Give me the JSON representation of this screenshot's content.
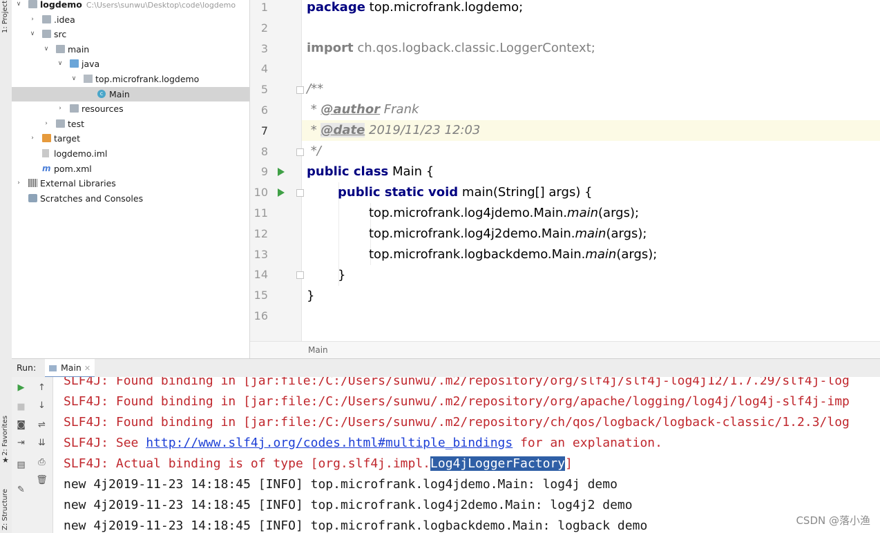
{
  "side_tabs": {
    "project": "1: Project",
    "favorites": "2: Favorites",
    "structure": "Z: Structure"
  },
  "project_tree": [
    {
      "label": "logdemo",
      "path": "C:\\Users\\sunwu\\Desktop\\code\\logdemo",
      "depth": 0,
      "expanded": true,
      "icon": "module-icon"
    },
    {
      "label": ".idea",
      "depth": 1,
      "expanded": false,
      "icon": "folder-icon"
    },
    {
      "label": "src",
      "depth": 1,
      "expanded": true,
      "icon": "folder-icon"
    },
    {
      "label": "main",
      "depth": 2,
      "expanded": true,
      "icon": "folder-icon"
    },
    {
      "label": "java",
      "depth": 3,
      "expanded": true,
      "icon": "source-folder-icon"
    },
    {
      "label": "top.microfrank.logdemo",
      "depth": 4,
      "expanded": true,
      "icon": "package-icon"
    },
    {
      "label": "Main",
      "depth": 5,
      "selected": true,
      "icon": "class-icon"
    },
    {
      "label": "resources",
      "depth": 3,
      "expanded": false,
      "icon": "resources-folder-icon"
    },
    {
      "label": "test",
      "depth": 2,
      "expanded": false,
      "icon": "folder-icon"
    },
    {
      "label": "target",
      "depth": 1,
      "expanded": false,
      "icon": "excluded-folder-icon"
    },
    {
      "label": "logdemo.iml",
      "depth": 1,
      "icon": "iml-file-icon"
    },
    {
      "label": "pom.xml",
      "depth": 1,
      "icon": "maven-icon"
    },
    {
      "label": "External Libraries",
      "depth": 0,
      "expanded": false,
      "icon": "libraries-icon"
    },
    {
      "label": "Scratches and Consoles",
      "depth": 0,
      "icon": "scratches-icon"
    }
  ],
  "editor": {
    "line_numbers": [
      "1",
      "2",
      "3",
      "4",
      "5",
      "6",
      "7",
      "8",
      "9",
      "10",
      "11",
      "12",
      "13",
      "14",
      "15",
      "16"
    ],
    "lines": {
      "l1_kw": "package",
      "l1_rest": " top.microfrank.logdemo;",
      "l3_kw": "import",
      "l3_rest": " ch.qos.logback.classic.LoggerContext;",
      "l5": "/**",
      "l6_pre": " * ",
      "l6_tag": "@author",
      "l6_val": " Frank",
      "l7_pre": " * ",
      "l7_tag": "@date",
      "l7_val": " 2019/11/23 12:03",
      "l8": " */",
      "l9_kw": "public class",
      "l9_rest": " Main {",
      "l10_kw": "public static void",
      "l10_rest": " main(String[] args) {",
      "l11_a": "top.microfrank.log4jdemo.Main.",
      "l11_m": "main",
      "l11_b": "(args);",
      "l12_a": "top.microfrank.log4j2demo.Main.",
      "l12_m": "main",
      "l12_b": "(args);",
      "l13_a": "top.microfrank.logbackdemo.Main.",
      "l13_m": "main",
      "l13_b": "(args);",
      "l14": "}",
      "l15": "}"
    },
    "breadcrumb": "Main"
  },
  "run_panel": {
    "label": "Run:",
    "tab": "Main",
    "console": {
      "c0": "SLF4J: Found binding in [jar:file:/C:/Users/sunwu/.m2/repository/org/slf4j/slf4j-log4j12/1.7.29/slf4j-log",
      "c1": "SLF4J: Found binding in [jar:file:/C:/Users/sunwu/.m2/repository/org/apache/logging/log4j/log4j-slf4j-imp",
      "c2": "SLF4J: Found binding in [jar:file:/C:/Users/sunwu/.m2/repository/ch/qos/logback/logback-classic/1.2.3/log",
      "c3_a": "SLF4J: See ",
      "c3_link": "http://www.slf4j.org/codes.html#multiple_bindings",
      "c3_b": " for an explanation.",
      "c4_a": "SLF4J: Actual binding is of type [org.slf4j.impl.",
      "c4_sel": "Log4jLoggerFactory",
      "c4_b": "]",
      "c5": "new 4j2019-11-23 14:18:45 [INFO] top.microfrank.log4jdemo.Main: log4j demo",
      "c6": "new 4j2019-11-23 14:18:45 [INFO] top.microfrank.log4j2demo.Main: log4j2 demo",
      "c7": "new 4j2019-11-23 14:18:45 [INFO] top.microfrank.logbackdemo.Main: logback demo"
    }
  },
  "watermark": "CSDN @落小渔",
  "colors": {
    "error_text": "#c0272d",
    "keyword": "#000080",
    "link": "#1d3fd6",
    "selection": "#2f5fa6",
    "run_green": "#3fa046"
  }
}
